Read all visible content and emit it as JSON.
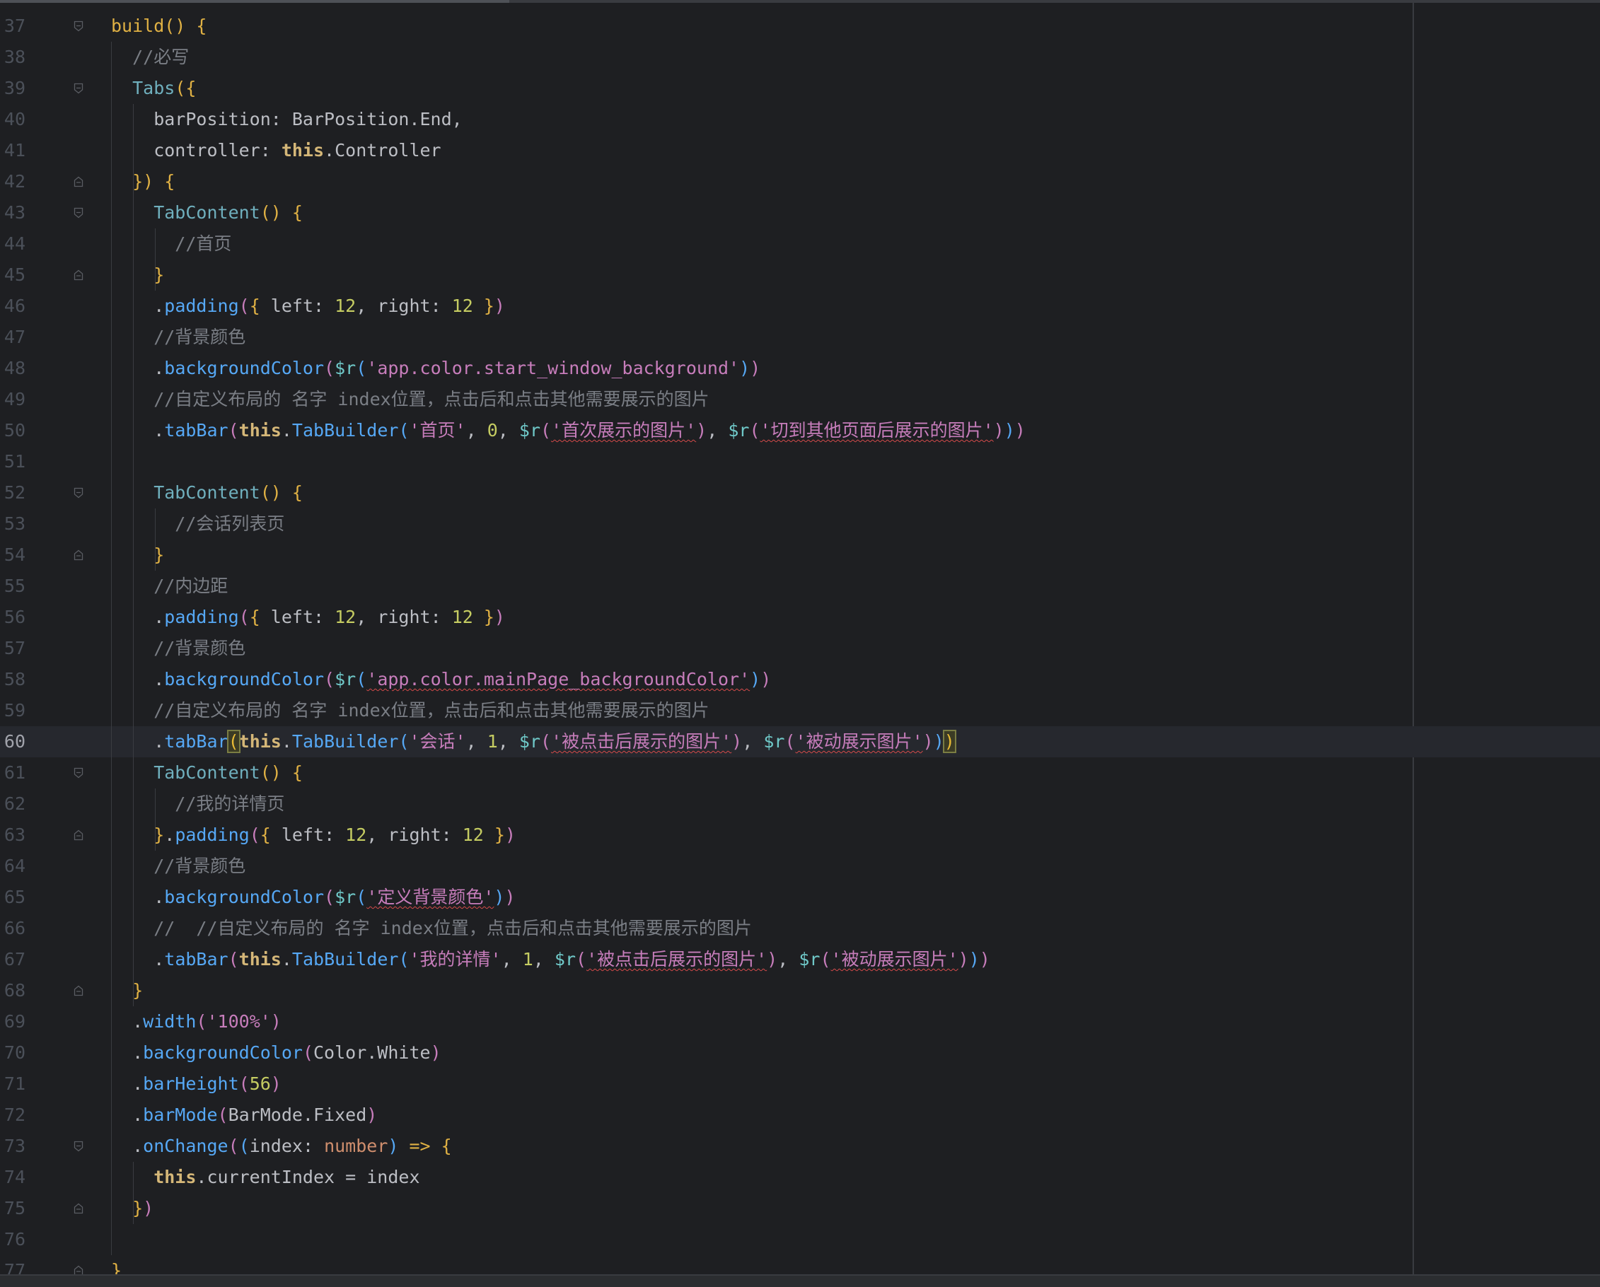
{
  "editor": {
    "current_line": 60,
    "lines": [
      {
        "n": "37",
        "fold": "start",
        "code": [
          [
            "br1",
            "build() {"
          ]
        ]
      },
      {
        "n": "38",
        "fold": "",
        "code": [
          [
            "cmt",
            "  //必写"
          ]
        ]
      },
      {
        "n": "39",
        "fold": "start",
        "code": [
          [
            "tag",
            "  Tabs"
          ],
          [
            "br1",
            "({"
          ]
        ]
      },
      {
        "n": "40",
        "fold": "",
        "code": [
          [
            "key",
            "    barPosition: BarPosition.End,"
          ]
        ]
      },
      {
        "n": "41",
        "fold": "",
        "code": [
          [
            "key",
            "    controller: "
          ],
          [
            "this",
            "this"
          ],
          [
            "key",
            ".Controller"
          ]
        ]
      },
      {
        "n": "42",
        "fold": "end",
        "code": [
          [
            "br1",
            "  }) {"
          ]
        ]
      },
      {
        "n": "43",
        "fold": "start",
        "code": [
          [
            "tag",
            "    TabContent"
          ],
          [
            "br1",
            "() {"
          ]
        ]
      },
      {
        "n": "44",
        "fold": "",
        "code": [
          [
            "cmt",
            "      //首页"
          ]
        ]
      },
      {
        "n": "45",
        "fold": "end",
        "code": [
          [
            "br1",
            "    }"
          ]
        ]
      },
      {
        "n": "46",
        "fold": "",
        "code": [
          [
            "key",
            "    ."
          ],
          [
            "fn",
            "padding"
          ],
          [
            "br2",
            "("
          ],
          [
            "br1",
            "{"
          ],
          [
            "key",
            " left: "
          ],
          [
            "lime",
            "12"
          ],
          [
            "key",
            ", right: "
          ],
          [
            "lime",
            "12"
          ],
          [
            "br1",
            " }"
          ],
          [
            "br2",
            ")"
          ]
        ]
      },
      {
        "n": "47",
        "fold": "",
        "code": [
          [
            "cmt",
            "    //背景颜色"
          ]
        ]
      },
      {
        "n": "48",
        "fold": "",
        "code": [
          [
            "key",
            "    ."
          ],
          [
            "fn",
            "backgroundColor"
          ],
          [
            "br2",
            "("
          ],
          [
            "cy",
            "$r"
          ],
          [
            "br3",
            "("
          ],
          [
            "str",
            "'app.color.start_window_background'"
          ],
          [
            "br3",
            ")"
          ],
          [
            "br2",
            ")"
          ]
        ]
      },
      {
        "n": "49",
        "fold": "",
        "code": [
          [
            "cmt",
            "    //自定义布局的 名字 index位置，点击后和点击其他需要展示的图片"
          ]
        ]
      },
      {
        "n": "50",
        "fold": "",
        "code": [
          [
            "key",
            "    ."
          ],
          [
            "fn",
            "tabBar"
          ],
          [
            "br2",
            "("
          ],
          [
            "this",
            "this"
          ],
          [
            "key",
            "."
          ],
          [
            "fn",
            "TabBuilder"
          ],
          [
            "br3",
            "("
          ],
          [
            "str",
            "'首页'"
          ],
          [
            "key",
            ", "
          ],
          [
            "lime",
            "0"
          ],
          [
            "key",
            ", "
          ],
          [
            "cy",
            "$r"
          ],
          [
            "br2",
            "("
          ],
          [
            "strsq",
            "'首次展示的图片'"
          ],
          [
            "br2",
            ")"
          ],
          [
            "key",
            ", "
          ],
          [
            "cy",
            "$r"
          ],
          [
            "br2",
            "("
          ],
          [
            "strsq",
            "'切到其他页面后展示的图片'"
          ],
          [
            "br2",
            ")"
          ],
          [
            "br3",
            ")"
          ],
          [
            "br2",
            ")"
          ]
        ]
      },
      {
        "n": "51",
        "fold": "",
        "code": []
      },
      {
        "n": "52",
        "fold": "start",
        "code": [
          [
            "tag",
            "    TabContent"
          ],
          [
            "br1",
            "() {"
          ]
        ]
      },
      {
        "n": "53",
        "fold": "",
        "code": [
          [
            "cmt",
            "      //会话列表页"
          ]
        ]
      },
      {
        "n": "54",
        "fold": "end",
        "code": [
          [
            "br1",
            "    }"
          ]
        ]
      },
      {
        "n": "55",
        "fold": "",
        "code": [
          [
            "cmt",
            "    //内边距"
          ]
        ]
      },
      {
        "n": "56",
        "fold": "",
        "code": [
          [
            "key",
            "    ."
          ],
          [
            "fn",
            "padding"
          ],
          [
            "br2",
            "("
          ],
          [
            "br1",
            "{"
          ],
          [
            "key",
            " left: "
          ],
          [
            "lime",
            "12"
          ],
          [
            "key",
            ", right: "
          ],
          [
            "lime",
            "12"
          ],
          [
            "br1",
            " }"
          ],
          [
            "br2",
            ")"
          ]
        ]
      },
      {
        "n": "57",
        "fold": "",
        "code": [
          [
            "cmt",
            "    //背景颜色"
          ]
        ]
      },
      {
        "n": "58",
        "fold": "",
        "code": [
          [
            "key",
            "    ."
          ],
          [
            "fn",
            "backgroundColor"
          ],
          [
            "br2",
            "("
          ],
          [
            "cy",
            "$r"
          ],
          [
            "br3",
            "("
          ],
          [
            "strsq",
            "'app.color.mainPage_backgroundColor'"
          ],
          [
            "br3",
            ")"
          ],
          [
            "br2",
            ")"
          ]
        ]
      },
      {
        "n": "59",
        "fold": "",
        "code": [
          [
            "cmt",
            "    //自定义布局的 名字 index位置，点击后和点击其他需要展示的图片"
          ]
        ]
      },
      {
        "n": "60",
        "fold": "",
        "code": [
          [
            "key",
            "    ."
          ],
          [
            "fn",
            "tabBar"
          ],
          [
            "match",
            "("
          ],
          [
            "this",
            "this"
          ],
          [
            "key",
            "."
          ],
          [
            "fn",
            "TabBuilder"
          ],
          [
            "br3",
            "("
          ],
          [
            "str",
            "'会话'"
          ],
          [
            "key",
            ", "
          ],
          [
            "lime",
            "1"
          ],
          [
            "key",
            ", "
          ],
          [
            "cy",
            "$r"
          ],
          [
            "br2",
            "("
          ],
          [
            "strsq",
            "'被点击后展示的图片'"
          ],
          [
            "br2",
            ")"
          ],
          [
            "key",
            ", "
          ],
          [
            "cy",
            "$r"
          ],
          [
            "br2",
            "("
          ],
          [
            "strsq",
            "'被动展示图片'"
          ],
          [
            "br2",
            ")"
          ],
          [
            "br3",
            ")"
          ],
          [
            "match",
            ")"
          ]
        ]
      },
      {
        "n": "61",
        "fold": "start",
        "code": [
          [
            "tag",
            "    TabContent"
          ],
          [
            "br1",
            "() {"
          ]
        ]
      },
      {
        "n": "62",
        "fold": "",
        "code": [
          [
            "cmt",
            "      //我的详情页"
          ]
        ]
      },
      {
        "n": "63",
        "fold": "end",
        "code": [
          [
            "br1",
            "    }"
          ],
          [
            "key",
            "."
          ],
          [
            "fn",
            "padding"
          ],
          [
            "br2",
            "("
          ],
          [
            "br1",
            "{"
          ],
          [
            "key",
            " left: "
          ],
          [
            "lime",
            "12"
          ],
          [
            "key",
            ", right: "
          ],
          [
            "lime",
            "12"
          ],
          [
            "br1",
            " }"
          ],
          [
            "br2",
            ")"
          ]
        ]
      },
      {
        "n": "64",
        "fold": "",
        "code": [
          [
            "cmt",
            "    //背景颜色"
          ]
        ]
      },
      {
        "n": "65",
        "fold": "",
        "code": [
          [
            "key",
            "    ."
          ],
          [
            "fn",
            "backgroundColor"
          ],
          [
            "br2",
            "("
          ],
          [
            "cy",
            "$r"
          ],
          [
            "br3",
            "("
          ],
          [
            "strsq",
            "'定义背景颜色'"
          ],
          [
            "br3",
            ")"
          ],
          [
            "br2",
            ")"
          ]
        ]
      },
      {
        "n": "66",
        "fold": "",
        "code": [
          [
            "cmt",
            "    //  //自定义布局的 名字 index位置，点击后和点击其他需要展示的图片"
          ]
        ]
      },
      {
        "n": "67",
        "fold": "",
        "code": [
          [
            "key",
            "    ."
          ],
          [
            "fn",
            "tabBar"
          ],
          [
            "br2",
            "("
          ],
          [
            "this",
            "this"
          ],
          [
            "key",
            "."
          ],
          [
            "fn",
            "TabBuilder"
          ],
          [
            "br3",
            "("
          ],
          [
            "str",
            "'我的详情'"
          ],
          [
            "key",
            ", "
          ],
          [
            "lime",
            "1"
          ],
          [
            "key",
            ", "
          ],
          [
            "cy",
            "$r"
          ],
          [
            "br2",
            "("
          ],
          [
            "strsq",
            "'被点击后展示的图片'"
          ],
          [
            "br2",
            ")"
          ],
          [
            "key",
            ", "
          ],
          [
            "cy",
            "$r"
          ],
          [
            "br2",
            "("
          ],
          [
            "strsq",
            "'被动展示图片'"
          ],
          [
            "br2",
            ")"
          ],
          [
            "br3",
            ")"
          ],
          [
            "br2",
            ")"
          ]
        ]
      },
      {
        "n": "68",
        "fold": "end",
        "code": [
          [
            "br1",
            "  }"
          ]
        ]
      },
      {
        "n": "69",
        "fold": "",
        "code": [
          [
            "key",
            "  ."
          ],
          [
            "fn",
            "width"
          ],
          [
            "br2",
            "("
          ],
          [
            "str",
            "'100%'"
          ],
          [
            "br2",
            ")"
          ]
        ]
      },
      {
        "n": "70",
        "fold": "",
        "code": [
          [
            "key",
            "  ."
          ],
          [
            "fn",
            "backgroundColor"
          ],
          [
            "br2",
            "("
          ],
          [
            "key",
            "Color.White"
          ],
          [
            "br2",
            ")"
          ]
        ]
      },
      {
        "n": "71",
        "fold": "",
        "code": [
          [
            "key",
            "  ."
          ],
          [
            "fn",
            "barHeight"
          ],
          [
            "br2",
            "("
          ],
          [
            "lime",
            "56"
          ],
          [
            "br2",
            ")"
          ]
        ]
      },
      {
        "n": "72",
        "fold": "",
        "code": [
          [
            "key",
            "  ."
          ],
          [
            "fn",
            "barMode"
          ],
          [
            "br2",
            "("
          ],
          [
            "key",
            "BarMode.Fixed"
          ],
          [
            "br2",
            ")"
          ]
        ]
      },
      {
        "n": "73",
        "fold": "start",
        "code": [
          [
            "key",
            "  ."
          ],
          [
            "fn",
            "onChange"
          ],
          [
            "br2",
            "("
          ],
          [
            "br3",
            "("
          ],
          [
            "key",
            "index: "
          ],
          [
            "kw",
            "number"
          ],
          [
            "br3",
            ")"
          ],
          [
            "key",
            " "
          ],
          [
            "br1",
            "=> {"
          ]
        ]
      },
      {
        "n": "74",
        "fold": "",
        "code": [
          [
            "this",
            "    this"
          ],
          [
            "key",
            ".currentIndex = index"
          ]
        ]
      },
      {
        "n": "75",
        "fold": "end",
        "code": [
          [
            "br1",
            "  }"
          ],
          [
            "br2",
            ")"
          ]
        ]
      },
      {
        "n": "76",
        "fold": "",
        "code": []
      },
      {
        "n": "77",
        "fold": "end",
        "code": [
          [
            "br1",
            "}"
          ]
        ]
      }
    ]
  }
}
